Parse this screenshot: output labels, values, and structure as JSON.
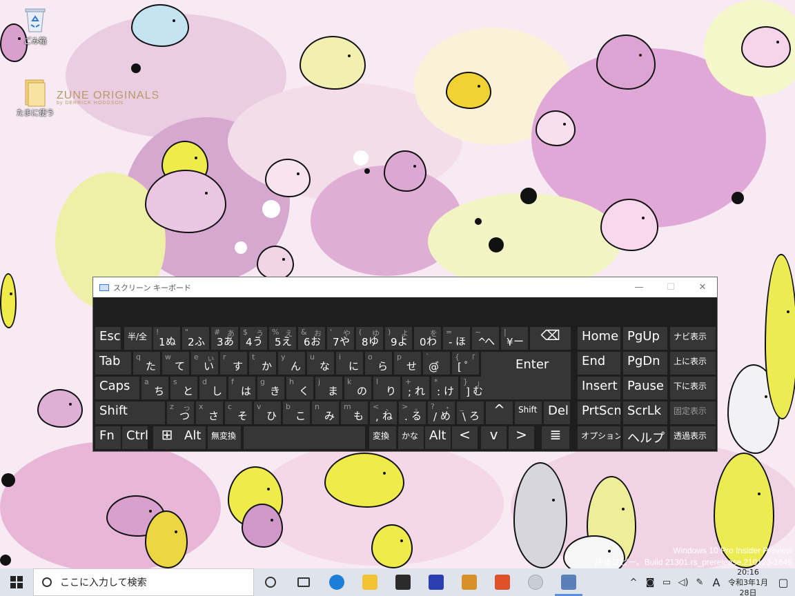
{
  "desktop": {
    "icons": [
      {
        "label": "ごみ箱",
        "icon": "recycle-bin-icon"
      },
      {
        "label": "たまに使う",
        "icon": "folder-icon"
      }
    ],
    "zune": {
      "brand": "ZUNE ORIGINALS",
      "byline": "by DERRICK HODGSON"
    },
    "watermark": {
      "line1": "Windows 10 Pro Insider Preview",
      "line2": "評価コピー。Build 21301.rs_prerelease.210123-1645"
    }
  },
  "osk": {
    "title": "スクリーン キーボード",
    "controls": {
      "minimize": "—",
      "maximize": "☐",
      "close": "✕"
    },
    "rows": [
      [
        {
          "id": "esc",
          "label": "Esc"
        },
        {
          "id": "hankaku",
          "label": "半/全"
        },
        {
          "id": "1",
          "top": "!",
          "sym": "1",
          "kana": "ぬ"
        },
        {
          "id": "2",
          "top": "\"",
          "sym": "2",
          "kana": "ふ"
        },
        {
          "id": "3",
          "top": "#",
          "topk": "あ",
          "sym": "3",
          "kana": "あ"
        },
        {
          "id": "4",
          "top": "$",
          "topk": "う",
          "sym": "4",
          "kana": "う"
        },
        {
          "id": "5",
          "top": "%",
          "topk": "え",
          "sym": "5",
          "kana": "え"
        },
        {
          "id": "6",
          "top": "&",
          "topk": "お",
          "sym": "6",
          "kana": "お"
        },
        {
          "id": "7",
          "top": "'",
          "topk": "や",
          "sym": "7",
          "kana": "や"
        },
        {
          "id": "8",
          "top": "(",
          "topk": "ゆ",
          "sym": "8",
          "kana": "ゆ"
        },
        {
          "id": "9",
          "top": ")",
          "topk": "よ",
          "sym": "9",
          "kana": "よ"
        },
        {
          "id": "0",
          "topk": "を",
          "sym": "0",
          "kana": "わ"
        },
        {
          "id": "minus",
          "top": "=",
          "sym": "-",
          "kana": "ほ"
        },
        {
          "id": "caret",
          "top": "~",
          "sym": "^",
          "kana": "へ"
        },
        {
          "id": "yen",
          "top": "|",
          "sym": "¥",
          "kana": "ー"
        },
        {
          "id": "backspace",
          "label": "⌫"
        }
      ],
      [
        {
          "id": "tab",
          "label": "Tab"
        },
        {
          "id": "q",
          "top": "q",
          "kana": "た"
        },
        {
          "id": "w",
          "top": "w",
          "kana": "て"
        },
        {
          "id": "e",
          "top": "e",
          "topk": "ぃ",
          "kana": "い"
        },
        {
          "id": "r",
          "top": "r",
          "kana": "す"
        },
        {
          "id": "t",
          "top": "t",
          "kana": "か"
        },
        {
          "id": "y",
          "top": "y",
          "kana": "ん"
        },
        {
          "id": "u",
          "top": "u",
          "kana": "な"
        },
        {
          "id": "i",
          "top": "i",
          "kana": "に"
        },
        {
          "id": "o",
          "top": "o",
          "kana": "ら"
        },
        {
          "id": "p",
          "top": "p",
          "kana": "せ"
        },
        {
          "id": "at",
          "top": "`",
          "sym": "@",
          "kana": "゛"
        },
        {
          "id": "bracket",
          "top": "{",
          "topk": "「",
          "sym": "[",
          "kana": "゜"
        },
        {
          "id": "enter",
          "label": "Enter"
        }
      ],
      [
        {
          "id": "caps",
          "label": "Caps"
        },
        {
          "id": "a",
          "top": "a",
          "kana": "ち"
        },
        {
          "id": "s",
          "top": "s",
          "kana": "と"
        },
        {
          "id": "d",
          "top": "d",
          "kana": "し"
        },
        {
          "id": "f",
          "top": "f",
          "kana": "は"
        },
        {
          "id": "g",
          "top": "g",
          "kana": "き"
        },
        {
          "id": "h",
          "top": "h",
          "kana": "く"
        },
        {
          "id": "j",
          "top": "j",
          "kana": "ま"
        },
        {
          "id": "k",
          "top": "k",
          "kana": "の"
        },
        {
          "id": "l",
          "top": "l",
          "kana": "り"
        },
        {
          "id": "semicolon",
          "top": "+",
          "sym": ";",
          "kana": "れ"
        },
        {
          "id": "colon",
          "top": "*",
          "sym": ":",
          "kana": "け"
        },
        {
          "id": "rbracket",
          "top": "}",
          "topk": "」",
          "sym": "]",
          "kana": "む"
        }
      ],
      [
        {
          "id": "lshift",
          "label": "Shift"
        },
        {
          "id": "z",
          "top": "z",
          "topk": "っ",
          "kana": "つ"
        },
        {
          "id": "x",
          "top": "x",
          "kana": "さ"
        },
        {
          "id": "c",
          "top": "c",
          "kana": "そ"
        },
        {
          "id": "v",
          "top": "v",
          "kana": "ひ"
        },
        {
          "id": "b",
          "top": "b",
          "kana": "こ"
        },
        {
          "id": "n",
          "top": "n",
          "kana": "み"
        },
        {
          "id": "m",
          "top": "m",
          "kana": "も"
        },
        {
          "id": "comma",
          "top": "<",
          "topk": "、",
          "sym": ",",
          "kana": "ね"
        },
        {
          "id": "period",
          "top": ">",
          "topk": "。",
          "sym": ".",
          "kana": "る"
        },
        {
          "id": "slash",
          "top": "?",
          "topk": "・",
          "sym": "/",
          "kana": "め"
        },
        {
          "id": "backslash",
          "top": "_",
          "sym": "\\",
          "kana": "ろ"
        },
        {
          "id": "up",
          "label": "^"
        },
        {
          "id": "rshift",
          "label": "Shift"
        },
        {
          "id": "del",
          "label": "Del"
        }
      ],
      [
        {
          "id": "fn",
          "label": "Fn"
        },
        {
          "id": "ctrl",
          "label": "Ctrl"
        },
        {
          "id": "win",
          "label": "⊞"
        },
        {
          "id": "alt",
          "label": "Alt"
        },
        {
          "id": "muhenkan",
          "label": "無変換"
        },
        {
          "id": "space",
          "label": ""
        },
        {
          "id": "henkan",
          "label": "変換"
        },
        {
          "id": "kana",
          "label": "かな"
        },
        {
          "id": "ralt",
          "label": "Alt"
        },
        {
          "id": "left",
          "label": "<"
        },
        {
          "id": "down",
          "label": "v"
        },
        {
          "id": "right",
          "label": ">"
        },
        {
          "id": "menu",
          "label": "≣"
        }
      ]
    ],
    "nav": [
      {
        "id": "home",
        "label": "Home"
      },
      {
        "id": "pgup",
        "label": "PgUp"
      },
      {
        "id": "navi",
        "label": "ナビ表示"
      },
      {
        "id": "end",
        "label": "End"
      },
      {
        "id": "pgdn",
        "label": "PgDn"
      },
      {
        "id": "uepos",
        "label": "上に表示"
      },
      {
        "id": "insert",
        "label": "Insert"
      },
      {
        "id": "pause",
        "label": "Pause"
      },
      {
        "id": "shitapos",
        "label": "下に表示"
      },
      {
        "id": "prtscn",
        "label": "PrtScn"
      },
      {
        "id": "scrlk",
        "label": "ScrLk"
      },
      {
        "id": "kotei",
        "label": "固定表示"
      },
      {
        "id": "options",
        "label": "オプション"
      },
      {
        "id": "help",
        "label": "ヘルプ"
      },
      {
        "id": "toka",
        "label": "透過表示"
      }
    ]
  },
  "taskbar": {
    "search_placeholder": "ここに入力して検索",
    "apps": [
      {
        "name": "cortana-icon",
        "color": "#333333"
      },
      {
        "name": "task-view-icon",
        "color": "#333333"
      },
      {
        "name": "edge-icon",
        "color": "#1b7fd8"
      },
      {
        "name": "file-explorer-icon",
        "color": "#f2c233"
      },
      {
        "name": "store-icon",
        "color": "#2b2b2b"
      },
      {
        "name": "kanji-app-icon",
        "color": "#2a3fb0"
      },
      {
        "name": "mahjong-app-icon",
        "color": "#d8902a"
      },
      {
        "name": "brave-icon",
        "color": "#e0512a"
      },
      {
        "name": "sphere-app-icon",
        "color": "#c9ced6"
      },
      {
        "name": "onscreen-keyboard-icon",
        "color": "#5a7fb8"
      }
    ],
    "tray": {
      "chevron": "^",
      "ime": "A",
      "time": "20:16",
      "date": "令和3年1月28日"
    }
  }
}
